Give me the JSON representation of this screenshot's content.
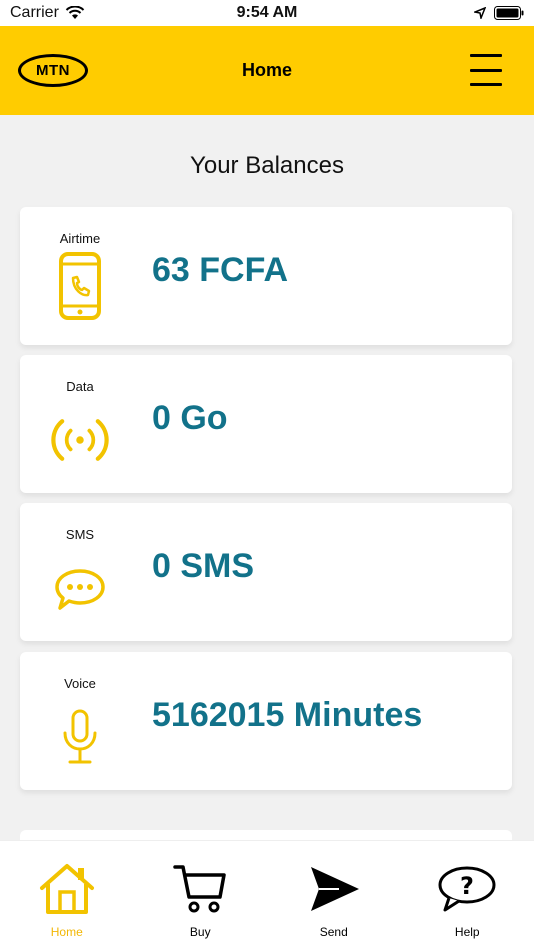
{
  "status_bar": {
    "carrier": "Carrier",
    "time": "9:54 AM"
  },
  "header": {
    "logo_text": "MTN",
    "title": "Home"
  },
  "section_title": "Your Balances",
  "balances": [
    {
      "label": "Airtime",
      "value": "63 FCFA",
      "icon": "phone-icon"
    },
    {
      "label": "Data",
      "value": "0 Go",
      "icon": "signal-icon"
    },
    {
      "label": "SMS",
      "value": "0 SMS",
      "icon": "chat-bubble-icon"
    },
    {
      "label": "Voice",
      "value": "5162015 Minutes",
      "icon": "microphone-icon"
    }
  ],
  "nav": [
    {
      "label": "Home",
      "icon": "home-icon",
      "active": true
    },
    {
      "label": "Buy",
      "icon": "cart-icon",
      "active": false
    },
    {
      "label": "Send",
      "icon": "send-icon",
      "active": false
    },
    {
      "label": "Help",
      "icon": "help-icon",
      "active": false
    }
  ],
  "colors": {
    "brand": "#ffcc00",
    "value": "#12728a",
    "icon": "#f2c300",
    "active_nav": "#f2b705"
  }
}
